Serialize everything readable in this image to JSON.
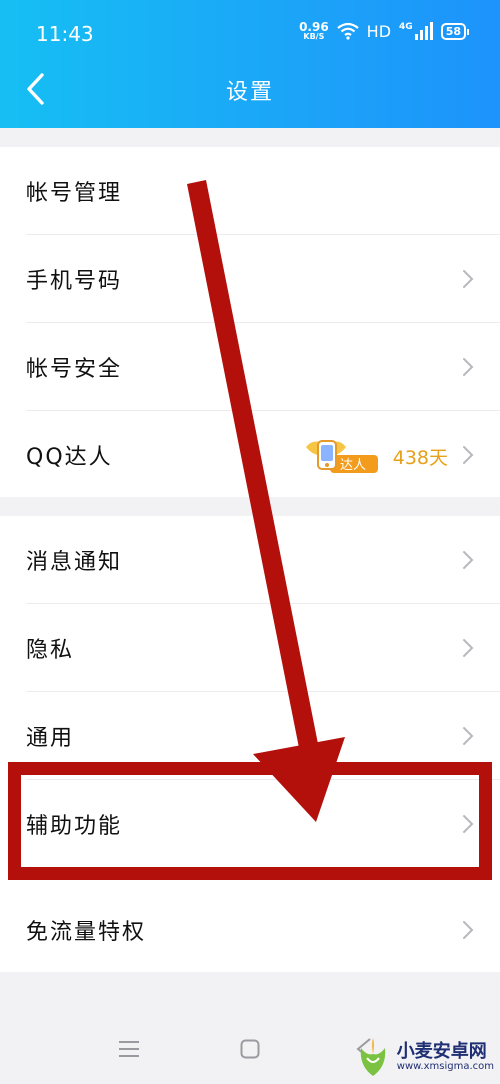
{
  "status_bar": {
    "time": "11:43",
    "speed_value": "0.96",
    "speed_unit": "KB/S",
    "hd": "HD",
    "network": "4G",
    "battery": "58"
  },
  "header": {
    "title": "设置"
  },
  "groups": [
    {
      "items": [
        {
          "label": "帐号管理"
        },
        {
          "label": "手机号码"
        },
        {
          "label": "帐号安全"
        },
        {
          "label": "QQ达人",
          "badge_text": "达人",
          "days": "438天"
        }
      ]
    },
    {
      "items": [
        {
          "label": "消息通知"
        },
        {
          "label": "隐私"
        },
        {
          "label": "通用"
        },
        {
          "label": "辅助功能"
        },
        {
          "label": "免流量特权"
        }
      ]
    }
  ],
  "colors": {
    "header_start": "#16bff3",
    "header_end": "#1d93fb",
    "annotation_red": "#b3100c",
    "daren_orange": "#e6a019"
  },
  "watermark": {
    "title": "小麦安卓网",
    "url": "www.xmsigma.com"
  }
}
